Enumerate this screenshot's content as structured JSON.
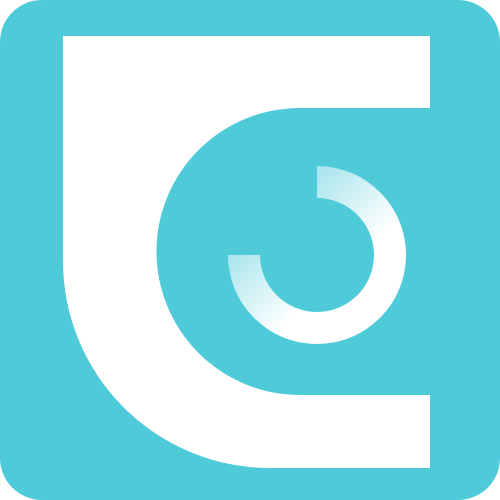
{
  "app_icon": {
    "name": "app-logo",
    "colors": {
      "background": "#4ecad9",
      "foreground": "#ffffff",
      "ring_fade": "#8fdde7"
    }
  }
}
